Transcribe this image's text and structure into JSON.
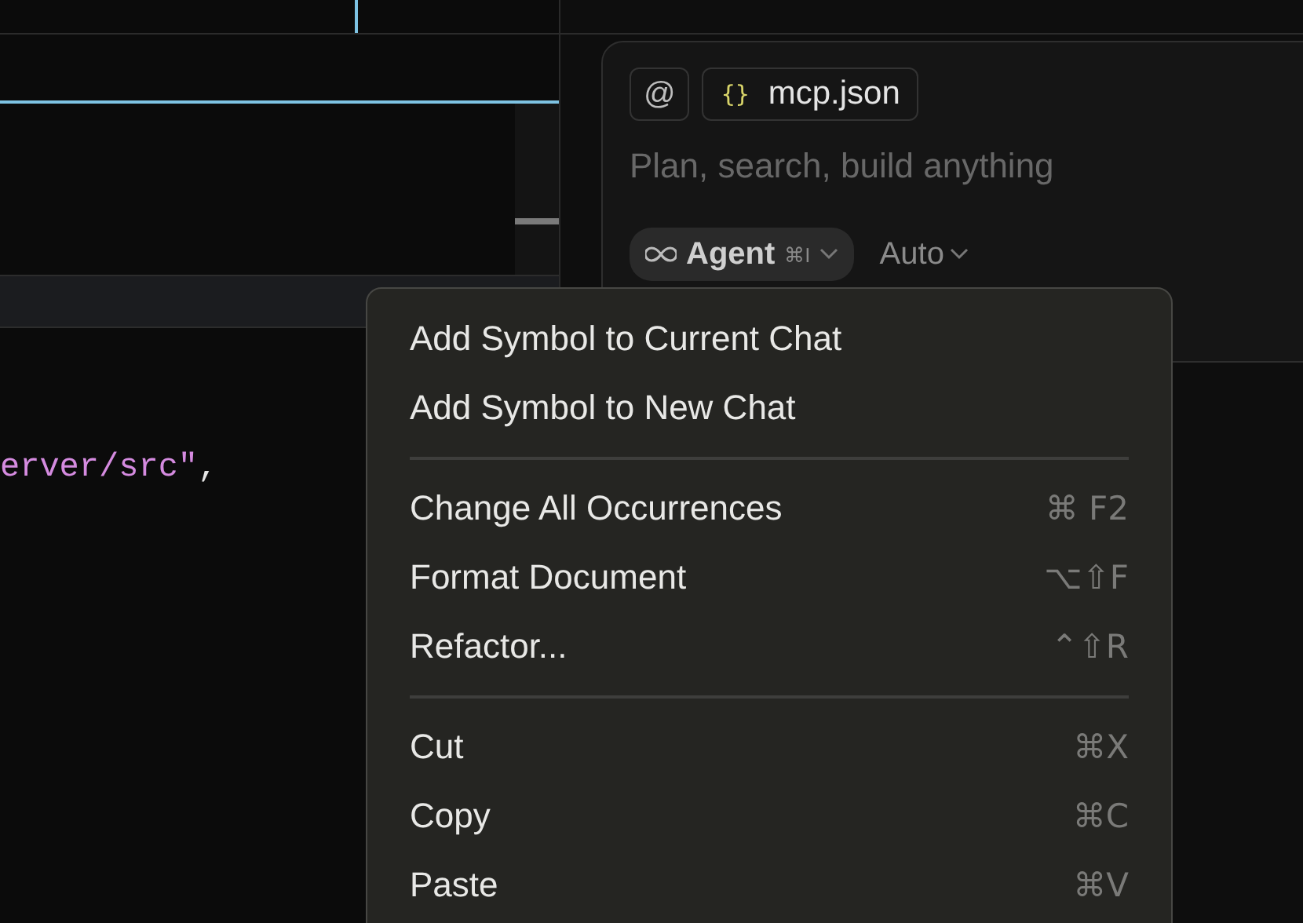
{
  "editor": {
    "code_lines": [
      {
        "tokens": [
          {
            "kind": "string",
            "text": "erver/src\""
          },
          {
            "kind": "punct",
            "text": ","
          }
        ]
      }
    ]
  },
  "chat": {
    "context_chips": [
      {
        "kind": "mention",
        "text": "@"
      },
      {
        "kind": "file",
        "icon": "{}",
        "text": "mcp.json"
      }
    ],
    "input": {
      "placeholder": "Plan, search, build anything"
    },
    "mode": {
      "label": "Agent",
      "shortcut": "⌘I"
    },
    "model": {
      "label": "Auto"
    }
  },
  "context_menu": {
    "groups": [
      [
        {
          "label": "Add Symbol to Current Chat"
        },
        {
          "label": "Add Symbol to New Chat"
        }
      ],
      [
        {
          "label": "Change All Occurrences",
          "shortcut": "⌘ F2"
        },
        {
          "label": "Format Document",
          "shortcut": "⌥⇧F"
        },
        {
          "label": "Refactor...",
          "shortcut": "⌃⇧R"
        }
      ],
      [
        {
          "label": "Cut",
          "shortcut": "⌘X"
        },
        {
          "label": "Copy",
          "shortcut": "⌘C"
        },
        {
          "label": "Paste",
          "shortcut": "⌘V"
        }
      ]
    ]
  }
}
